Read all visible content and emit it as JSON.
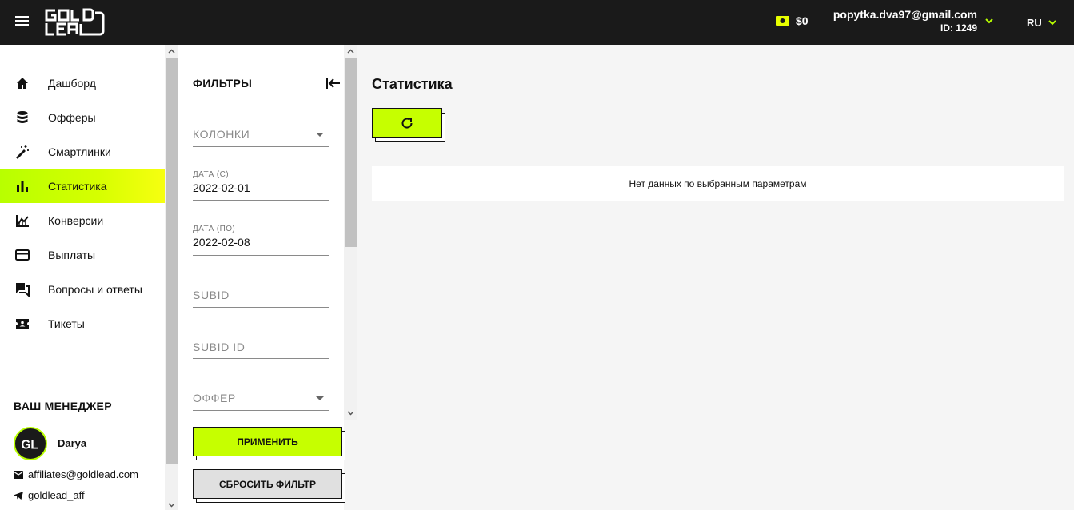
{
  "header": {
    "logo_text": "GOLD LEAD",
    "balance": "$0",
    "user_email": "popytka.dva97@gmail.com",
    "user_id": "ID: 1249",
    "language": "RU",
    "accent_color": "#b8ff00",
    "bg_color": "#1a1a1a"
  },
  "sidebar": {
    "items": [
      {
        "label": "Дашборд",
        "icon": "home-icon"
      },
      {
        "label": "Офферы",
        "icon": "database-icon"
      },
      {
        "label": "Смартлинки",
        "icon": "magic-wand-icon"
      },
      {
        "label": "Статистика",
        "icon": "bar-chart-icon",
        "active": true
      },
      {
        "label": "Конверсии",
        "icon": "trend-chart-icon"
      },
      {
        "label": "Выплаты",
        "icon": "credit-card-icon"
      },
      {
        "label": "Вопросы и ответы",
        "icon": "faq-icon"
      },
      {
        "label": "Тикеты",
        "icon": "ticket-icon"
      }
    ],
    "manager": {
      "title": "ВАШ МЕНЕДЖЕР",
      "name": "Darya",
      "email": "affiliates@goldlead.com",
      "telegram": "goldlead_aff"
    }
  },
  "filters": {
    "title": "ФИЛЬТРЫ",
    "columns_placeholder": "КОЛОНКИ",
    "date_from_label": "ДАТА (С)",
    "date_from_value": "2022-02-01",
    "date_to_label": "ДАТА (ПО)",
    "date_to_value": "2022-02-08",
    "subid_placeholder": "SUBID",
    "subid_id_placeholder": "SUBID ID",
    "offer_placeholder": "ОФФЕР",
    "apply_label": "ПРИМЕНИТЬ",
    "reset_label": "СБРОСИТЬ ФИЛЬТР"
  },
  "main": {
    "title": "Статистика",
    "empty_message": "Нет данных по выбранным параметрам"
  }
}
